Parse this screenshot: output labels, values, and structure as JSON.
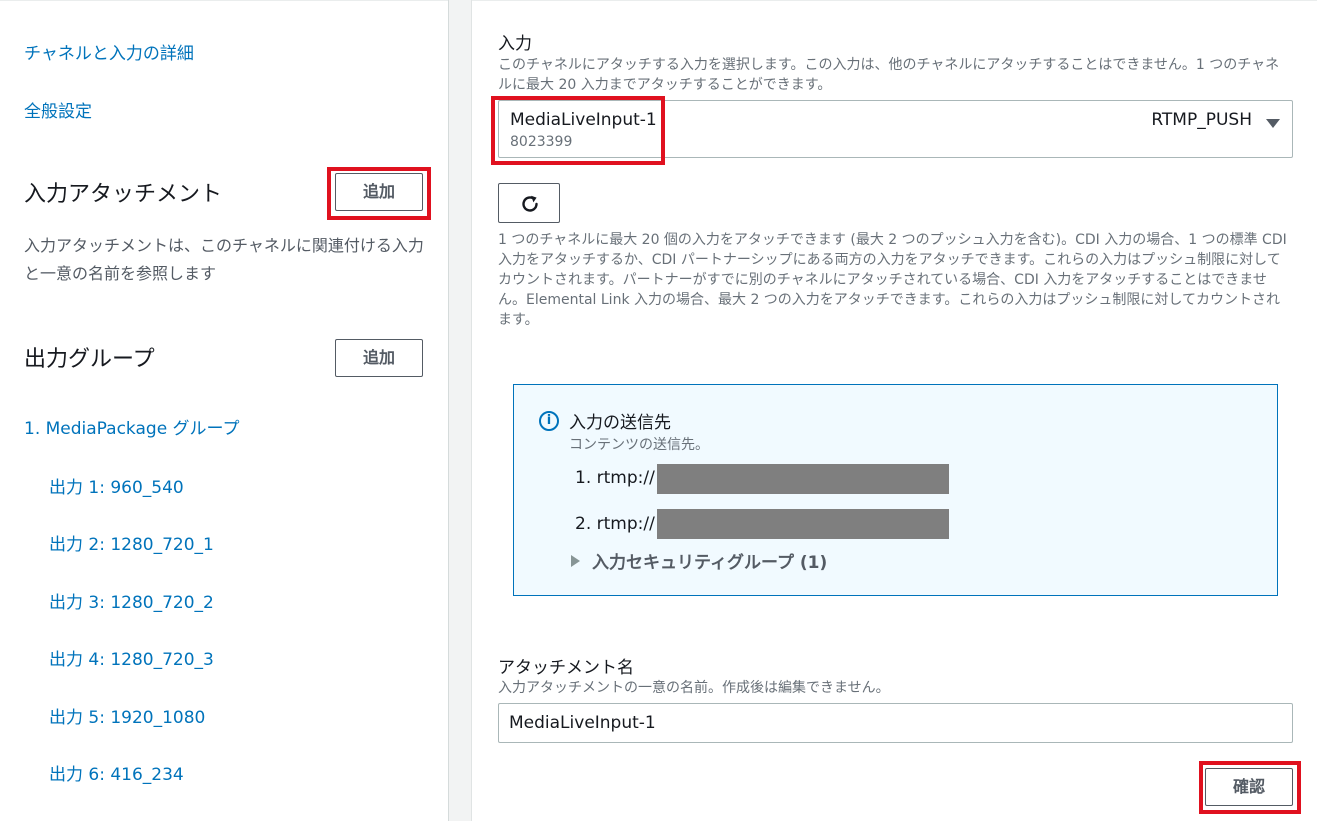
{
  "sidebar": {
    "links": [
      {
        "label": "チャネルと入力の詳細"
      },
      {
        "label": "全般設定"
      }
    ],
    "input_attachments": {
      "title": "入力アタッチメント",
      "add_label": "追加",
      "description": "入力アタッチメントは、このチャネルに関連付ける入力と一意の名前を参照します"
    },
    "output_groups": {
      "title": "出力グループ",
      "add_label": "追加",
      "group_label": "1. MediaPackage グループ",
      "outputs": [
        "出力 1: 960_540",
        "出力 2: 1280_720_1",
        "出力 3: 1280_720_2",
        "出力 4: 1280_720_3",
        "出力 5: 1920_1080",
        "出力 6: 416_234"
      ]
    }
  },
  "main": {
    "input": {
      "label": "入力",
      "description": "このチャネルにアタッチする入力を選択します。この入力は、他のチャネルにアタッチすることはできません。1 つのチャネルに最大 20 入力までアタッチすることができます。",
      "selected_name": "MediaLiveInput-1",
      "selected_id": "8023399",
      "selected_type": "RTMP_PUSH",
      "note": "1 つのチャネルに最大 20 個の入力をアタッチできます (最大 2 つのプッシュ入力を含む)。CDI 入力の場合、1 つの標準 CDI 入力をアタッチするか、CDI パートナーシップにある両方の入力をアタッチできます。これらの入力はプッシュ制限に対してカウントされます。パートナーがすでに別のチャネルにアタッチされている場合、CDI 入力をアタッチすることはできません。Elemental Link 入力の場合、最大 2 つの入力をアタッチできます。これらの入力はプッシュ制限に対してカウントされます。"
    },
    "destinations": {
      "title": "入力の送信先",
      "subtitle": "コンテンツの送信先。",
      "endpoints": [
        "1. rtmp://",
        "2. rtmp://"
      ],
      "security_group": "入力セキュリティグループ (1)"
    },
    "attachment_name": {
      "label": "アタッチメント名",
      "description": "入力アタッチメントの一意の名前。作成後は編集できません。",
      "value": "MediaLiveInput-1"
    },
    "confirm_label": "確認"
  },
  "colors": {
    "link": "#0073bb",
    "highlight": "#e0111f",
    "info_bg": "#f1faff",
    "redaction": "#7f7f7f"
  }
}
